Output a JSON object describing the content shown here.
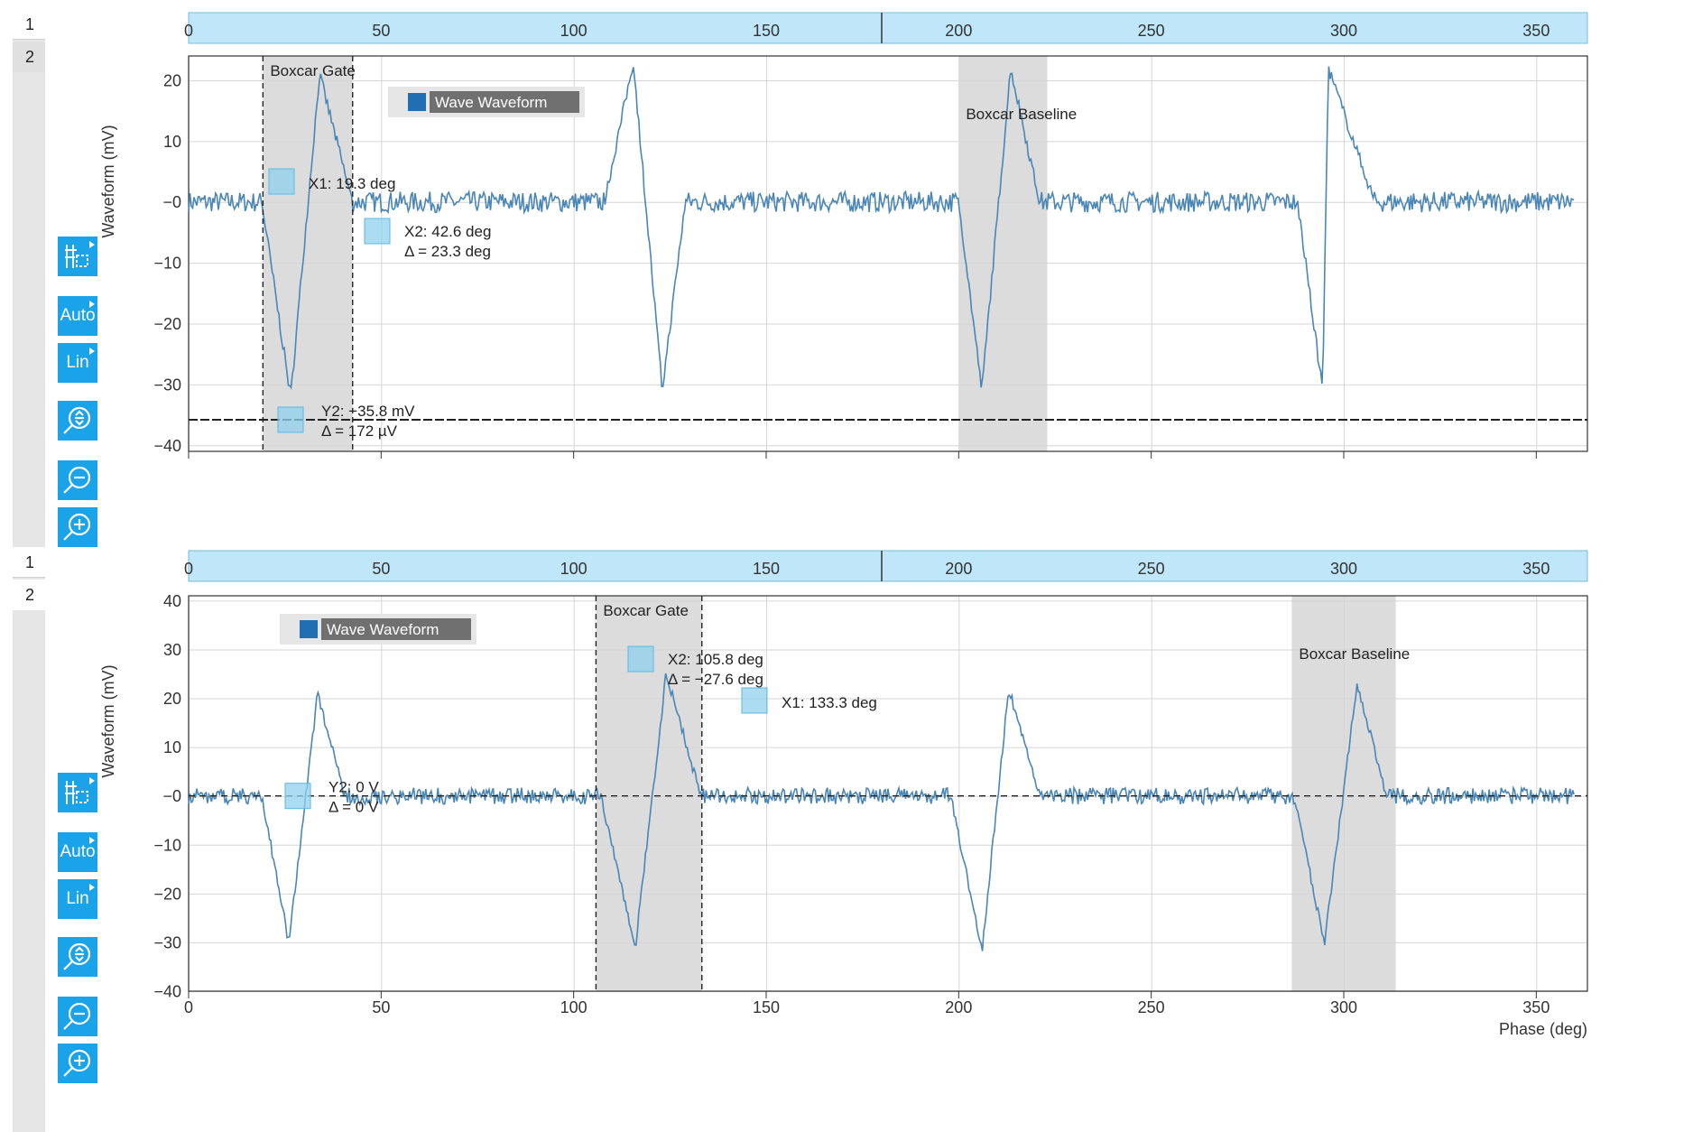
{
  "ui": {
    "tab_one": "1",
    "tab_two": "2",
    "tools": {
      "split_icon": "cursor-split-icon",
      "auto_label": "Auto",
      "lin_label": "Lin",
      "zoom_fit_icon": "zoom-fit-icon",
      "zoom_out_icon": "zoom-out-icon",
      "zoom_in_icon": "zoom-in-icon"
    },
    "accent_color": "#1aa3e8",
    "axis_band_color": "#bfe6f9",
    "trace_color": "#4a86b5",
    "gate_color": "#dcdcdc"
  },
  "chart_data": [
    {
      "type": "line",
      "xlabel": "",
      "ylabel": "Waveform (mV)",
      "xlim": [
        0,
        360
      ],
      "ylim": [
        -41,
        24
      ],
      "xticks": [
        0,
        50,
        100,
        150,
        200,
        250,
        300,
        350
      ],
      "yticks": [
        -40,
        -30,
        -20,
        -10,
        0,
        10,
        20
      ],
      "ytick_labels": [
        "−40",
        "−30",
        "−20",
        "−10",
        "−0",
        "10",
        "20"
      ],
      "legend": "Wave Waveform",
      "series": [
        {
          "name": "Wave Waveform",
          "pulses": [
            {
              "start": 19.0,
              "neg_x": 26.5,
              "neg_y": -32,
              "pos_x": 34.0,
              "pos_y": 21,
              "end": 42.5
            },
            {
              "start": 108.0,
              "neg_x": 123.0,
              "neg_y": -31,
              "pos_x": 115.5,
              "pos_y": 23,
              "end": 129.0
            },
            {
              "start": 200.0,
              "neg_x": 206.0,
              "neg_y": -31,
              "pos_x": 213.5,
              "pos_y": 22,
              "end": 221.0
            },
            {
              "start": 288.0,
              "neg_x": 294.5,
              "neg_y": -31,
              "pos_x": 296.0,
              "pos_y": 22,
              "end": 308.0
            }
          ]
        }
      ],
      "regions": [
        {
          "label": "Boxcar Gate",
          "x0": 19.3,
          "x1": 42.6,
          "dashed": true
        },
        {
          "label": "Boxcar Baseline",
          "x0": 200.0,
          "x1": 223.0,
          "dashed": false
        }
      ],
      "hline": -35.8,
      "cursors": {
        "x1_label": "X1: 19.3 deg",
        "x2_label": "X2: 42.6 deg",
        "dx_label": "Δ = 23.3 deg",
        "y2_label": "Y2: −35.8 mV",
        "dy_label": "Δ = 172 µV"
      },
      "top_axis_marker": 180
    },
    {
      "type": "line",
      "xlabel": "Phase (deg)",
      "ylabel": "Waveform (mV)",
      "xlim": [
        0,
        360
      ],
      "ylim": [
        -40,
        41
      ],
      "xticks": [
        0,
        50,
        100,
        150,
        200,
        250,
        300,
        350
      ],
      "yticks": [
        -40,
        -30,
        -20,
        -10,
        0,
        10,
        20,
        30,
        40
      ],
      "ytick_labels": [
        "−40",
        "−30",
        "−20",
        "−10",
        "−0",
        "10",
        "20",
        "30",
        "40"
      ],
      "legend": "Wave Waveform",
      "series": [
        {
          "name": "Wave Waveform",
          "pulses": [
            {
              "start": 19.0,
              "neg_x": 26.0,
              "neg_y": -30,
              "pos_x": 33.5,
              "pos_y": 21,
              "end": 40.5
            },
            {
              "start": 107.0,
              "neg_x": 116.0,
              "neg_y": -31,
              "pos_x": 124.0,
              "pos_y": 25,
              "end": 133.0
            },
            {
              "start": 198.0,
              "neg_x": 206.0,
              "neg_y": -32,
              "pos_x": 213.0,
              "pos_y": 22,
              "end": 221.0
            },
            {
              "start": 287.0,
              "neg_x": 295.0,
              "neg_y": -30,
              "pos_x": 303.5,
              "pos_y": 23,
              "end": 311.0
            }
          ]
        }
      ],
      "regions": [
        {
          "label": "Boxcar Gate",
          "x0": 105.8,
          "x1": 133.3,
          "dashed": true
        },
        {
          "label": "Boxcar Baseline",
          "x0": 286.5,
          "x1": 313.5,
          "dashed": false
        }
      ],
      "hline": 0,
      "cursors": {
        "x1_label": "X1: 133.3 deg",
        "x2_label": "X2: 105.8 deg",
        "dx_label": "Δ = −27.6 deg",
        "y2_label": "Y2: 0 V",
        "dy_label": "Δ = 0 V"
      },
      "top_axis_marker": 180
    }
  ]
}
